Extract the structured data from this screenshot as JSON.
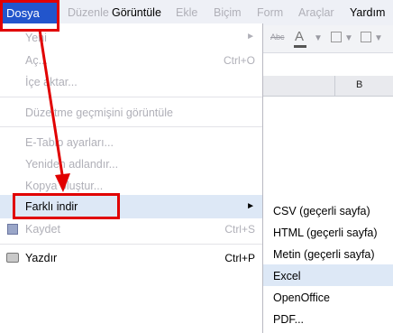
{
  "menubar": {
    "items": [
      "Dosya",
      "Düzenle",
      "Görüntüle",
      "Ekle",
      "Biçim",
      "Form",
      "Araçlar",
      "Yardım"
    ]
  },
  "toolbar": {
    "abc": "Abc",
    "text_a": "A"
  },
  "grid": {
    "column_b": "B"
  },
  "file_menu": {
    "items": [
      {
        "label": "Yeni",
        "shortcut": "►"
      },
      {
        "label": "Aç...",
        "shortcut": "Ctrl+O"
      },
      {
        "label": "İçe aktar...",
        "shortcut": ""
      },
      {
        "label": "Düzeltme geçmişini görüntüle",
        "shortcut": ""
      },
      {
        "label": "E-Tablo ayarları...",
        "shortcut": ""
      },
      {
        "label": "Yeniden adlandır...",
        "shortcut": ""
      },
      {
        "label": "Kopya oluştur...",
        "shortcut": ""
      },
      {
        "label": "Farklı indir",
        "shortcut": "►"
      },
      {
        "label": "Kaydet",
        "shortcut": "Ctrl+S"
      },
      {
        "label": "Yazdır",
        "shortcut": "Ctrl+P"
      }
    ]
  },
  "download_submenu": {
    "items": [
      "CSV (geçerli sayfa)",
      "HTML (geçerli sayfa)",
      "Metin (geçerli sayfa)",
      "Excel",
      "OpenOffice",
      "PDF..."
    ]
  },
  "colors": {
    "accent": "#2255cc",
    "highlight": "#dde8f6",
    "annotation": "#e10000"
  }
}
